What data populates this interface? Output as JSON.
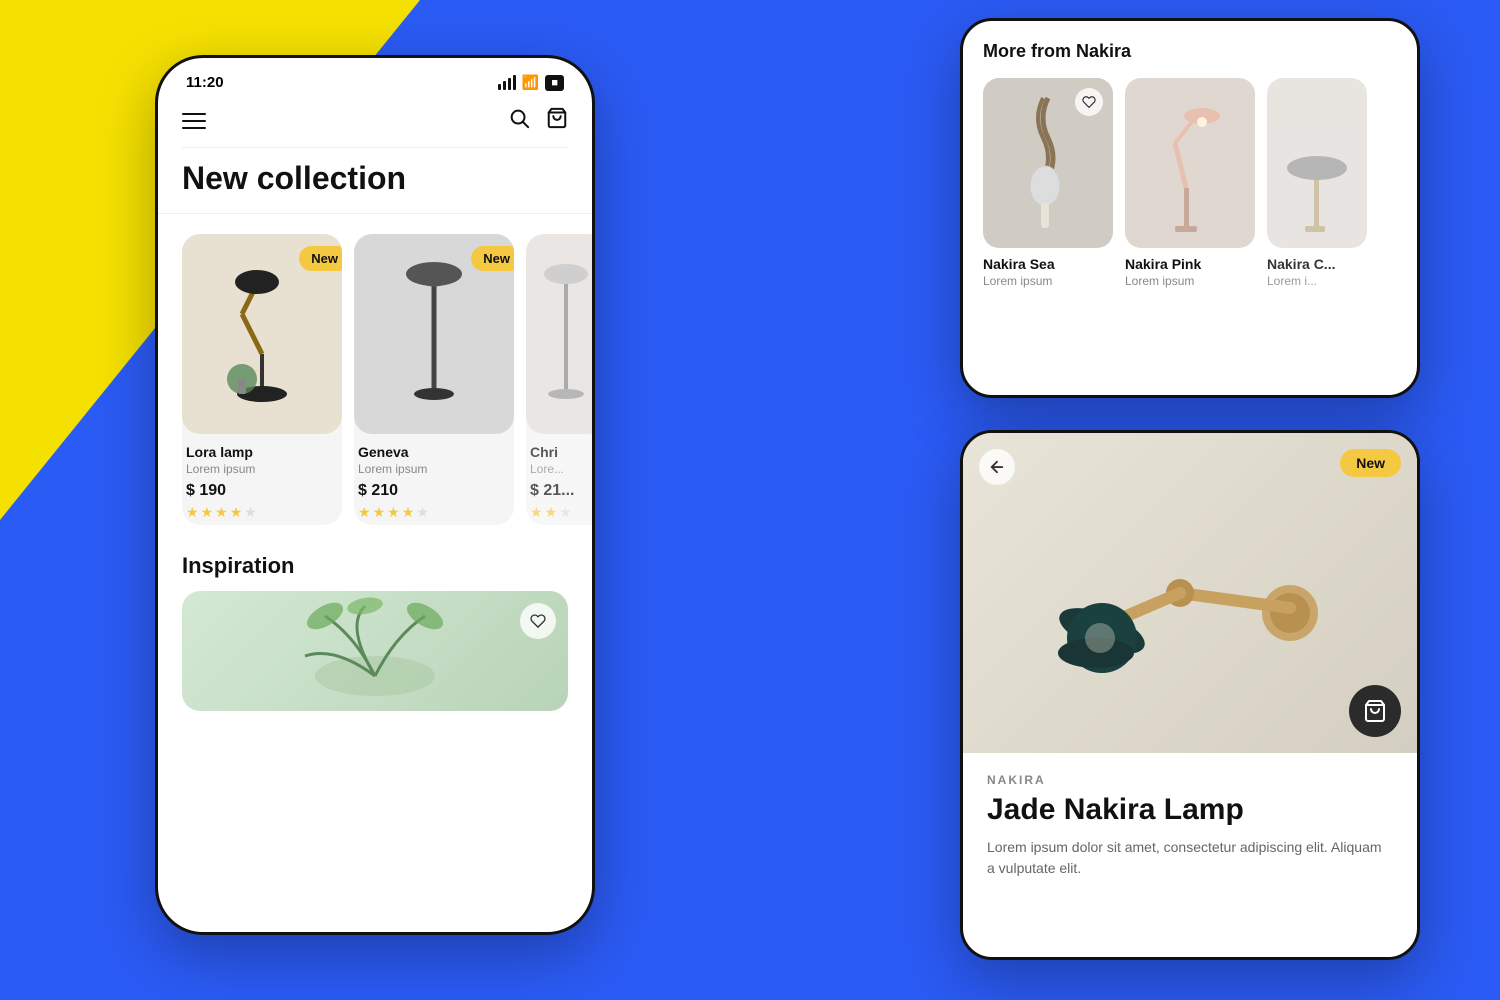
{
  "background": {
    "yellow_color": "#F5E100",
    "blue_color": "#2B5BF5"
  },
  "phone1": {
    "status": {
      "time": "11:20"
    },
    "nav": {
      "menu_label": "menu",
      "search_label": "search",
      "cart_label": "cart"
    },
    "page_title": "New collection",
    "products": [
      {
        "badge": "New",
        "name": "Lora lamp",
        "description": "Lorem ipsum",
        "price": "$ 190",
        "stars": 4,
        "max_stars": 5,
        "bg_color": "#e8e4d8"
      },
      {
        "badge": "New",
        "name": "Geneva",
        "description": "Lorem ipsum",
        "price": "$ 210",
        "stars": 4,
        "max_stars": 5,
        "bg_color": "#e0e0e0"
      },
      {
        "badge": "",
        "name": "Chri...",
        "description": "Lorem...",
        "price": "$ 21...",
        "stars": 2,
        "max_stars": 5,
        "bg_color": "#e8e8e8"
      }
    ],
    "inspiration": {
      "title": "Inspiration"
    }
  },
  "phone2": {
    "title": "More from Nakira",
    "products": [
      {
        "name": "Nakira Sea",
        "description": "Lorem ipsum",
        "bg_color": "#d4d0c8",
        "has_heart": true
      },
      {
        "name": "Nakira Pink",
        "description": "Lorem ipsum",
        "bg_color": "#e0d8d0",
        "has_heart": false
      },
      {
        "name": "Nakira C...",
        "description": "Lorem i...",
        "bg_color": "#e8e4e0",
        "has_heart": false
      }
    ]
  },
  "phone3": {
    "brand": "NAKIRA",
    "product_name": "Jade Nakira Lamp",
    "description": "Lorem ipsum dolor sit amet, consectetur adipiscing elit. Aliquam a vulputate elit.",
    "badge": "New",
    "back_icon": "←",
    "cart_icon": "🛒",
    "bg_color": "#e8e4d8"
  }
}
